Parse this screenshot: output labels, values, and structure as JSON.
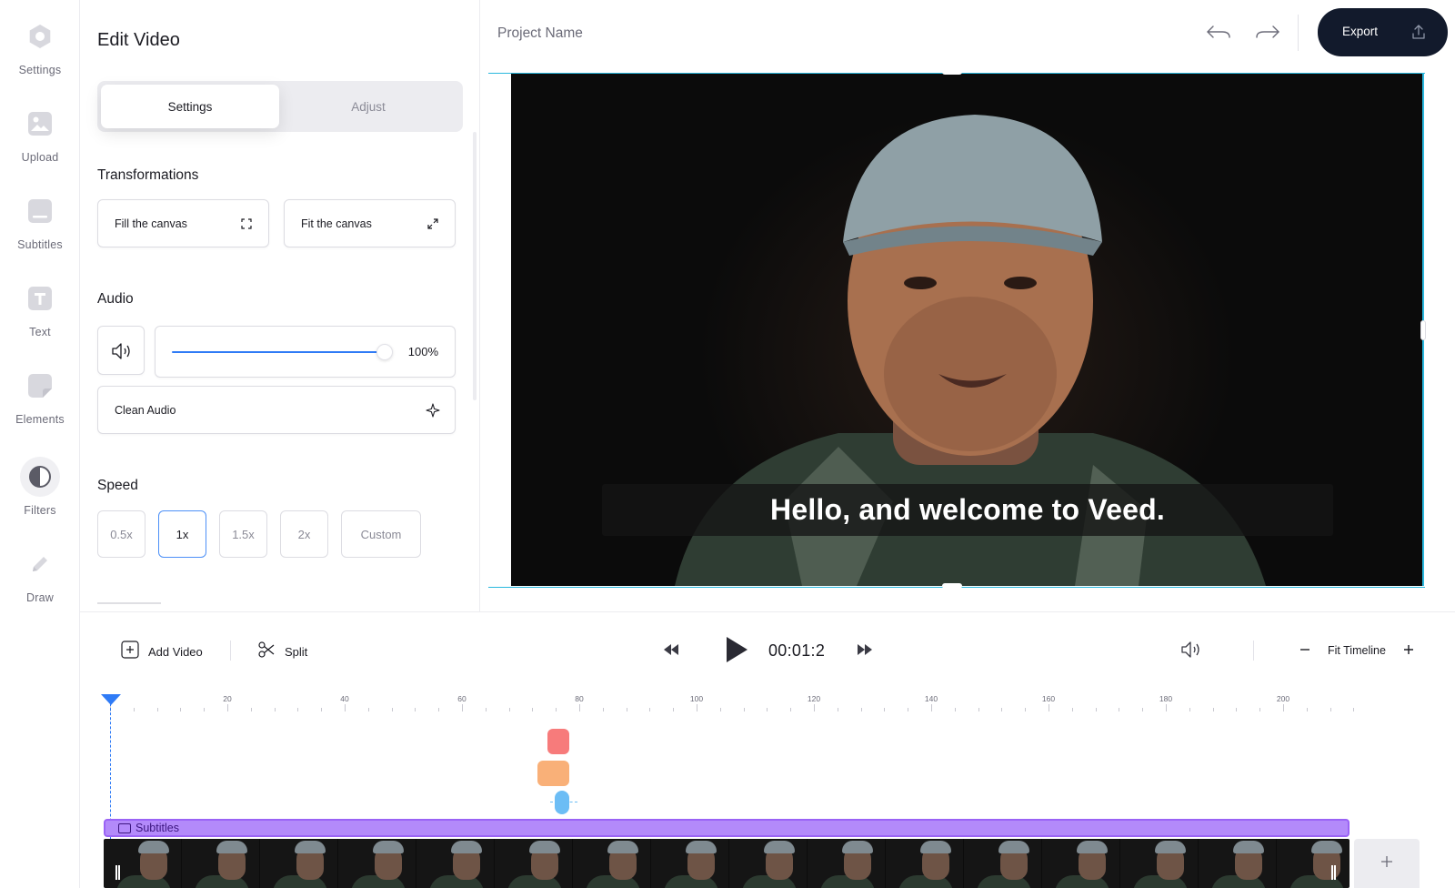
{
  "sidebar": {
    "items": [
      {
        "label": "Settings",
        "icon": "settings-icon"
      },
      {
        "label": "Upload",
        "icon": "upload-icon"
      },
      {
        "label": "Subtitles",
        "icon": "subtitles-icon"
      },
      {
        "label": "Text",
        "icon": "text-icon"
      },
      {
        "label": "Elements",
        "icon": "elements-icon"
      },
      {
        "label": "Filters",
        "icon": "filters-icon",
        "active": true
      },
      {
        "label": "Draw",
        "icon": "draw-icon"
      }
    ]
  },
  "panel": {
    "title": "Edit Video",
    "tabs": [
      {
        "label": "Settings",
        "active": true
      },
      {
        "label": "Adjust",
        "active": false
      }
    ],
    "transformations": {
      "title": "Transformations",
      "options": [
        {
          "label": "Fill the canvas",
          "icon": "fill-canvas-icon"
        },
        {
          "label": "Fit the canvas",
          "icon": "fit-canvas-icon"
        }
      ]
    },
    "audio": {
      "title": "Audio",
      "volume_level": 1.0,
      "volume_label": "100%",
      "clean_audio_label": "Clean Audio"
    },
    "speed": {
      "title": "Speed",
      "options": [
        "0.5x",
        "1x",
        "1.5x",
        "2x",
        "Custom"
      ],
      "selected": "1x"
    }
  },
  "header": {
    "project_name": "Project Name",
    "export_label": "Export"
  },
  "canvas": {
    "subtitle_text": "Hello, and welcome to Veed."
  },
  "timeline": {
    "add_video_label": "Add Video",
    "split_label": "Split",
    "timecode": "00:01:2",
    "fit_timeline_label": "Fit Timeline",
    "ruler_labels": [
      "20",
      "40",
      "60",
      "80",
      "100",
      "120",
      "140",
      "160",
      "180",
      "200"
    ],
    "subtitle_track_label": "Subtitles"
  },
  "colors": {
    "accent_blue": "#2f7bf6",
    "export_bg": "#121a2c",
    "selection_cyan": "#2ab8de",
    "subtitle_track": "#b38afa",
    "marker_red": "#f77b7b",
    "marker_orange": "#f9b078",
    "marker_blue": "#6cbdf5"
  }
}
